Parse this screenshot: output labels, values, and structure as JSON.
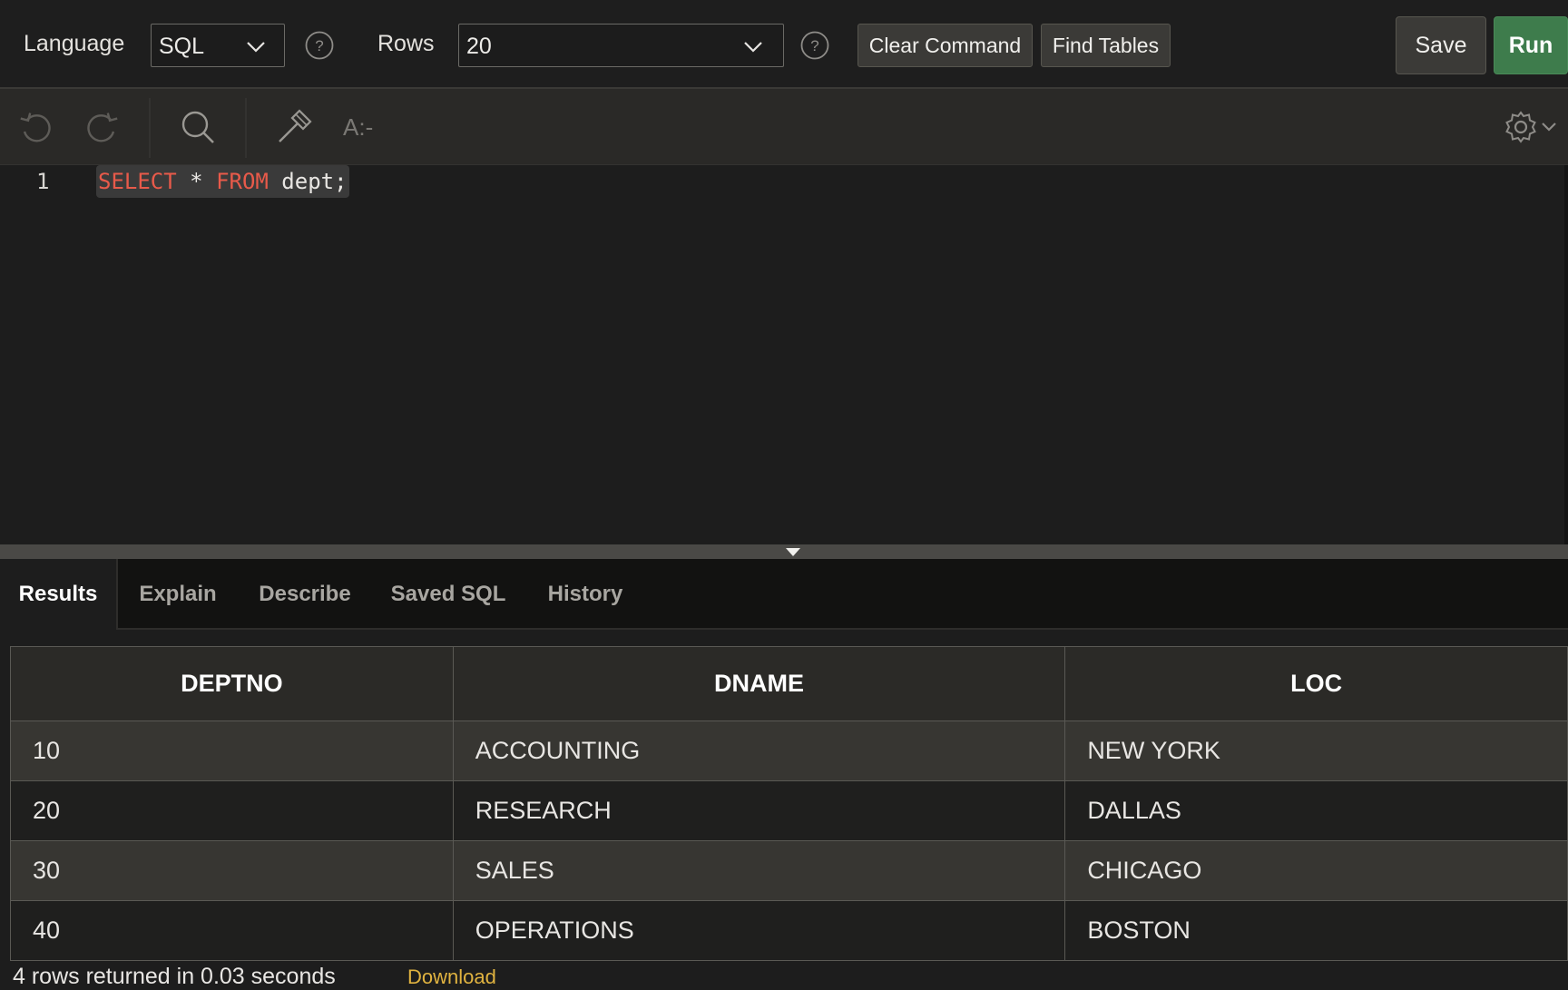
{
  "toolbar": {
    "language_label": "Language",
    "language_value": "SQL",
    "rows_label": "Rows",
    "rows_value": "20",
    "clear_command": "Clear Command",
    "find_tables": "Find Tables",
    "save": "Save",
    "run": "Run",
    "colors": {
      "run_bg": "#3e7c4c",
      "button_bg": "#3b3a37"
    }
  },
  "editor_toolbar": {
    "icons": [
      "undo-icon",
      "redo-icon",
      "search-icon",
      "hammer-icon",
      "text-format-icon",
      "gear-icon",
      "chevron-down-icon"
    ],
    "format_label": "A:-"
  },
  "editor": {
    "line_number": "1",
    "code": {
      "kw1": "SELECT",
      "op": " * ",
      "kw2": "FROM",
      "rest": " dept;"
    },
    "colors": {
      "keyword": "#e85a4a",
      "text": "#e8e6e3"
    }
  },
  "tabs": [
    {
      "label": "Results",
      "active": true
    },
    {
      "label": "Explain",
      "active": false
    },
    {
      "label": "Describe",
      "active": false
    },
    {
      "label": "Saved SQL",
      "active": false
    },
    {
      "label": "History",
      "active": false
    }
  ],
  "results": {
    "columns": [
      "DEPTNO",
      "DNAME",
      "LOC"
    ],
    "rows": [
      [
        "10",
        "ACCOUNTING",
        "NEW YORK"
      ],
      [
        "20",
        "RESEARCH",
        "DALLAS"
      ],
      [
        "30",
        "SALES",
        "CHICAGO"
      ],
      [
        "40",
        "OPERATIONS",
        "BOSTON"
      ]
    ],
    "status": "4 rows returned in 0.03 seconds",
    "download": "Download"
  }
}
